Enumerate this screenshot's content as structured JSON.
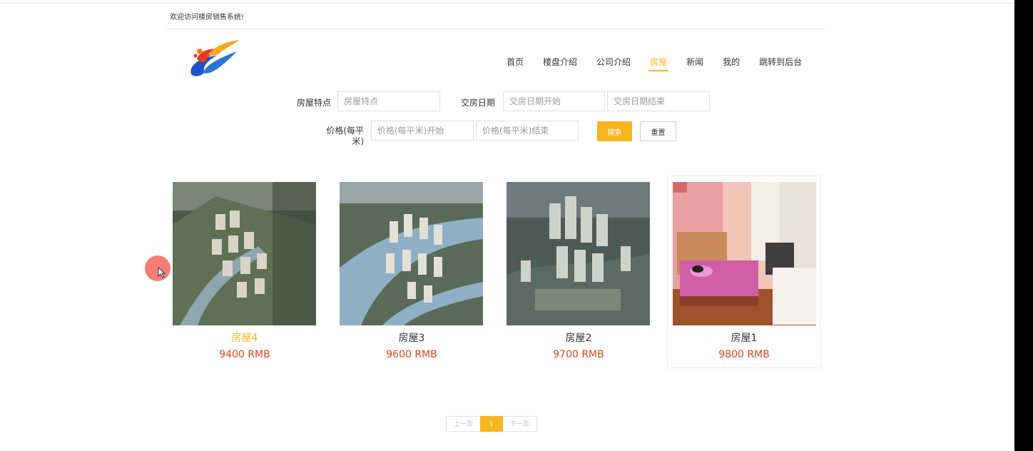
{
  "header": {
    "welcome": "欢迎访问楼房销售系统!"
  },
  "nav": {
    "items": [
      {
        "label": "首页",
        "active": false
      },
      {
        "label": "楼盘介绍",
        "active": false
      },
      {
        "label": "公司介绍",
        "active": false
      },
      {
        "label": "房屋",
        "active": true
      },
      {
        "label": "新闻",
        "active": false
      },
      {
        "label": "我的",
        "active": false
      },
      {
        "label": "跳转到后台",
        "active": false
      }
    ]
  },
  "search": {
    "feature_label": "房屋特点",
    "feature_placeholder": "房屋特点",
    "date_label": "交房日期",
    "date_start_placeholder": "交房日期开始",
    "date_end_placeholder": "交房日期结束",
    "price_label_line1": "价格(每平",
    "price_label_line2": "米)",
    "price_start_placeholder": "价格(每平米)开始",
    "price_end_placeholder": "价格(每平米)结束",
    "search_button": "搜索",
    "reset_button": "重置"
  },
  "houses": [
    {
      "name": "房屋4",
      "price": "9400 RMB"
    },
    {
      "name": "房屋3",
      "price": "9600 RMB"
    },
    {
      "name": "房屋2",
      "price": "9700 RMB"
    },
    {
      "name": "房屋1",
      "price": "9800 RMB"
    }
  ],
  "pagination": {
    "prev": "上一页",
    "current": "1",
    "next": "下一页"
  },
  "colors": {
    "accent": "#f7b520",
    "price": "#e0441c"
  }
}
